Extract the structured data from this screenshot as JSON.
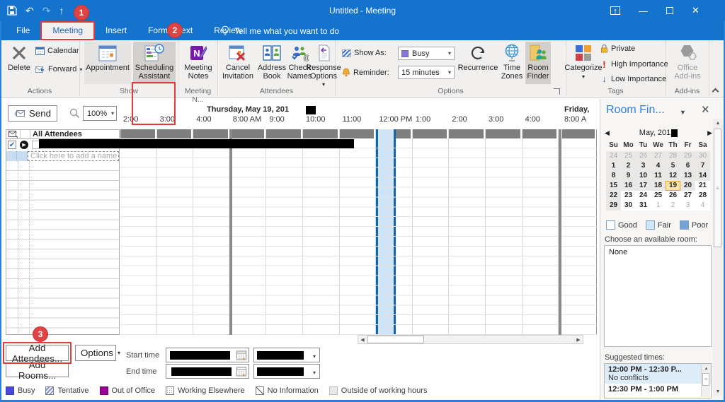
{
  "titlebar": {
    "title": "Untitled - Meeting"
  },
  "annotations": {
    "step1": "1",
    "step2": "2",
    "step3": "3"
  },
  "tabs": [
    {
      "label": "File",
      "active": false
    },
    {
      "label": "Meeting",
      "active": true
    },
    {
      "label": "Insert",
      "active": false
    },
    {
      "label": "Format Text",
      "active": false
    },
    {
      "label": "Review",
      "active": false
    }
  ],
  "tell_me": "Tell me what you want to do",
  "icons": {
    "undo": "↶",
    "redo": "↷",
    "prev_item": "↑",
    "next_item": "↓",
    "dropdown": "▾",
    "left_arrow": "◀",
    "right_arrow": "▶",
    "up_arrow": "▲",
    "down_arrow": "▼",
    "check": "✔",
    "close": "✕",
    "minimize": "—",
    "organizer_arrow": "▶"
  },
  "ribbon": {
    "actions": {
      "group": "Actions",
      "delete": "Delete",
      "calendar": "Calendar",
      "forward": "Forward"
    },
    "show": {
      "group": "Show",
      "appointment": "Appointment",
      "scheduling_line1": "Scheduling",
      "scheduling_line2": "Assistant"
    },
    "meeting_notes": {
      "group": "Meeting N...",
      "label_line1": "Meeting",
      "label_line2": "Notes"
    },
    "attendees": {
      "group": "Attendees",
      "cancel_line1": "Cancel",
      "cancel_line2": "Invitation",
      "address_line1": "Address",
      "address_line2": "Book",
      "check_line1": "Check",
      "check_line2": "Names",
      "response_line1": "Response",
      "response_line2": "Options"
    },
    "options": {
      "group": "Options",
      "show_as": "Show As:",
      "show_as_value": "Busy",
      "reminder": "Reminder:",
      "reminder_value": "15 minutes",
      "recurrence": "Recurrence",
      "time_zones_line1": "Time",
      "time_zones_line2": "Zones",
      "room_finder_line1": "Room",
      "room_finder_line2": "Finder"
    },
    "tags": {
      "group": "Tags",
      "categorize": "Categorize",
      "private": "Private",
      "high": "High Importance",
      "low": "Low Importance"
    },
    "addins": {
      "group": "Add-ins",
      "office_line1": "Office",
      "office_line2": "Add-ins"
    }
  },
  "scheduler": {
    "send": "Send",
    "zoom": "100%",
    "all_attendees": "All Attendees",
    "add_name_placeholder": "Click here to add a name",
    "day1": "Thursday, May 19, 201",
    "day2": "Friday,",
    "hours": [
      "2:00",
      "3:00",
      "4:00",
      "8:00 AM",
      "9:00",
      "10:00",
      "11:00",
      "12:00 PM",
      "1:00",
      "2:00",
      "3:00",
      "4:00"
    ],
    "friday_hour": "8:00 A"
  },
  "footer": {
    "add_attendees": "Add Attendees...",
    "options": "Options",
    "add_rooms": "Add Rooms...",
    "start_time": "Start time",
    "end_time": "End time",
    "legend": [
      {
        "label": "Busy",
        "k": "busy"
      },
      {
        "label": "Tentative",
        "k": "tentative"
      },
      {
        "label": "Out of Office",
        "k": "oof"
      },
      {
        "label": "Working Elsewhere",
        "k": "elsewhere"
      },
      {
        "label": "No Information",
        "k": "noinfo"
      },
      {
        "label": "Outside of working hours",
        "k": "outside"
      }
    ]
  },
  "room_finder": {
    "title": "Room Fin...",
    "month": "May, 201",
    "day_headers": [
      "Su",
      "Mo",
      "Tu",
      "We",
      "Th",
      "Fr",
      "Sa"
    ],
    "weeks": [
      [
        {
          "t": "24",
          "k": "dim"
        },
        {
          "t": "25",
          "k": "dim"
        },
        {
          "t": "26",
          "k": "dim"
        },
        {
          "t": "27",
          "k": "dim"
        },
        {
          "t": "28",
          "k": "dim"
        },
        {
          "t": "29",
          "k": "dim"
        },
        {
          "t": "30",
          "k": "dim"
        }
      ],
      [
        {
          "t": "1",
          "k": "gray"
        },
        {
          "t": "2",
          "k": "gray"
        },
        {
          "t": "3",
          "k": "gray"
        },
        {
          "t": "4",
          "k": "gray"
        },
        {
          "t": "5",
          "k": "gray"
        },
        {
          "t": "6",
          "k": "gray"
        },
        {
          "t": "7",
          "k": "gray"
        }
      ],
      [
        {
          "t": "8",
          "k": "gray"
        },
        {
          "t": "9",
          "k": "gray"
        },
        {
          "t": "10",
          "k": "gray"
        },
        {
          "t": "11",
          "k": "gray"
        },
        {
          "t": "12",
          "k": "gray"
        },
        {
          "t": "13",
          "k": "gray"
        },
        {
          "t": "14",
          "k": "gray"
        }
      ],
      [
        {
          "t": "15",
          "k": "gray"
        },
        {
          "t": "16",
          "k": "gray"
        },
        {
          "t": "17",
          "k": "gray"
        },
        {
          "t": "18",
          "k": "gray"
        },
        {
          "t": "19",
          "k": "sel"
        },
        {
          "t": "20",
          "k": "gray"
        },
        {
          "t": "21",
          "k": "white"
        }
      ],
      [
        {
          "t": "22",
          "k": "gray"
        },
        {
          "t": "23",
          "k": "white"
        },
        {
          "t": "24",
          "k": "white"
        },
        {
          "t": "25",
          "k": "white"
        },
        {
          "t": "26",
          "k": "white"
        },
        {
          "t": "27",
          "k": "white"
        },
        {
          "t": "28",
          "k": "white"
        }
      ],
      [
        {
          "t": "29",
          "k": "gray"
        },
        {
          "t": "30",
          "k": "white"
        },
        {
          "t": "31",
          "k": "white"
        },
        {
          "t": "1",
          "k": "dimw"
        },
        {
          "t": "2",
          "k": "dimw"
        },
        {
          "t": "3",
          "k": "dimw"
        },
        {
          "t": "4",
          "k": "dimw"
        }
      ]
    ],
    "availability": [
      {
        "label": "Good",
        "k": "good"
      },
      {
        "label": "Fair",
        "k": "fair"
      },
      {
        "label": "Poor",
        "k": "poor"
      }
    ],
    "choose_label": "Choose an available room:",
    "rooms": [
      "None"
    ],
    "suggested_label": "Suggested times:",
    "suggestions": [
      {
        "time": "12:00 PM - 12:30 P...",
        "detail": "No conflicts",
        "selected": true
      },
      {
        "time": "12:30 PM - 1:00 PM",
        "detail": "",
        "selected": false
      }
    ]
  },
  "colors": {
    "accent_blue": "#1373cd",
    "annotation_red": "#e23b3b",
    "selection_fill": "#cfe4f7",
    "selection_border": "#1565ad",
    "busy_legend": "#4848d8",
    "out_of_office": "#9b009b",
    "calendar_selected_day": "#fbe6a2"
  }
}
